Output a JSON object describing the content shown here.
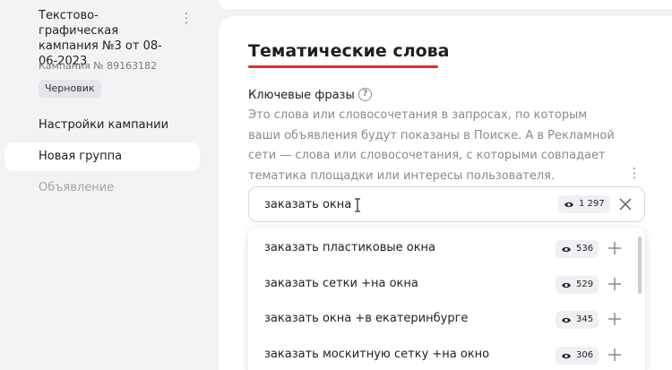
{
  "sidebar": {
    "campaign_title": "Текстово-графическая кампания №3 от 08-06-2023",
    "campaign_number": "Кампания № 89163182",
    "status_badge": "Черновик",
    "nav": [
      {
        "label": "Настройки кампании",
        "state": "normal"
      },
      {
        "label": "Новая группа",
        "state": "active"
      },
      {
        "label": "Объявление",
        "state": "disabled"
      }
    ]
  },
  "main": {
    "heading": "Тематические слова",
    "keywords_label": "Ключевые фразы",
    "description": "Это слова или словосочетания в запросах, по которым ваши объявления будут показаны в Поиске. А в Рекламной сети — слова или словосочетания, с которыми совпадает тематика площадки или интересы пользователя.",
    "input": {
      "value": "заказать окна",
      "count": "1 297"
    },
    "suggestions": [
      {
        "text": "заказать пластиковые окна",
        "count": "536"
      },
      {
        "text": "заказать сетки +на окна",
        "count": "529"
      },
      {
        "text": "заказать окна +в екатеринбурге",
        "count": "345"
      },
      {
        "text": "заказать москитную сетку +на окно",
        "count": "306"
      }
    ]
  },
  "colors": {
    "accent_underline": "#e52b2b",
    "background": "#f2f3f5"
  }
}
